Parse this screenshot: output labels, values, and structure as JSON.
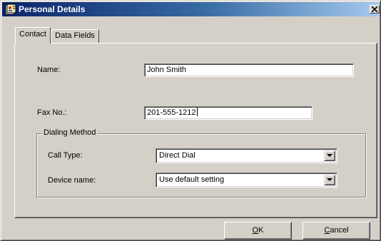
{
  "window": {
    "title": "Personal Details",
    "icon": "address-card-icon",
    "close_icon": "close-icon"
  },
  "tabs": [
    {
      "label": "Contact",
      "selected": true
    },
    {
      "label": "Data Fields",
      "selected": false
    }
  ],
  "contact": {
    "name_label": "Name:",
    "name_value": "John Smith",
    "fax_label": "Fax No.:",
    "fax_value": "201-555-1212"
  },
  "dialing_method": {
    "legend": "Dialing Method",
    "call_type_label": "Call Type:",
    "call_type_value": "Direct Dial",
    "device_name_label": "Device name:",
    "device_name_value": "Use default setting",
    "dropdown_icon": "chevron-down-icon"
  },
  "buttons": {
    "ok": {
      "mnemonic": "O",
      "rest": "K"
    },
    "cancel": {
      "mnemonic": "C",
      "rest": "ancel"
    }
  },
  "colors": {
    "titlebar_start": "#0a246a",
    "titlebar_end": "#a6caf0",
    "face": "#d4d0c8"
  }
}
